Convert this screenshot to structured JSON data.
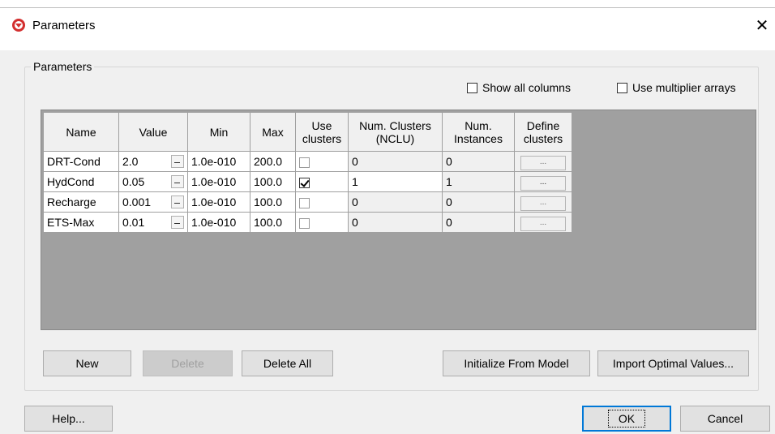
{
  "window": {
    "title": "Parameters",
    "close_glyph": "✕"
  },
  "group": {
    "label": "Parameters"
  },
  "options": {
    "show_all_columns": {
      "label": "Show all columns",
      "checked": false
    },
    "use_multiplier_arrays": {
      "label": "Use multiplier arrays",
      "checked": false
    }
  },
  "table": {
    "headers": {
      "name": "Name",
      "value": "Value",
      "min": "Min",
      "max": "Max",
      "use_clusters_1": "Use",
      "use_clusters_2": "clusters",
      "num_clusters_1": "Num. Clusters",
      "num_clusters_2": "(NCLU)",
      "num_instances_1": "Num.",
      "num_instances_2": "Instances",
      "define_clusters_1": "Define",
      "define_clusters_2": "clusters"
    },
    "rows": [
      {
        "name": "DRT-Cond",
        "value": "2.0",
        "min": "1.0e-010",
        "max": "200.0",
        "use_clusters": false,
        "num_clusters": "0",
        "num_instances": "0",
        "define": "..."
      },
      {
        "name": "HydCond",
        "value": "0.05",
        "min": "1.0e-010",
        "max": "100.0",
        "use_clusters": true,
        "num_clusters": "1",
        "num_instances": "1",
        "define": "..."
      },
      {
        "name": "Recharge",
        "value": "0.001",
        "min": "1.0e-010",
        "max": "100.0",
        "use_clusters": false,
        "num_clusters": "0",
        "num_instances": "0",
        "define": "..."
      },
      {
        "name": "ETS-Max",
        "value": "0.01",
        "min": "1.0e-010",
        "max": "100.0",
        "use_clusters": false,
        "num_clusters": "0",
        "num_instances": "0",
        "define": "..."
      }
    ]
  },
  "buttons": {
    "new": "New",
    "delete": "Delete",
    "delete_all": "Delete All",
    "initialize": "Initialize From Model",
    "import_optimal": "Import Optimal Values...",
    "help": "Help...",
    "ok": "OK",
    "cancel": "Cancel"
  },
  "colors": {
    "accent": "#0078d7",
    "app_icon": "#d32f2f",
    "grid_background": "#a0a0a0"
  }
}
